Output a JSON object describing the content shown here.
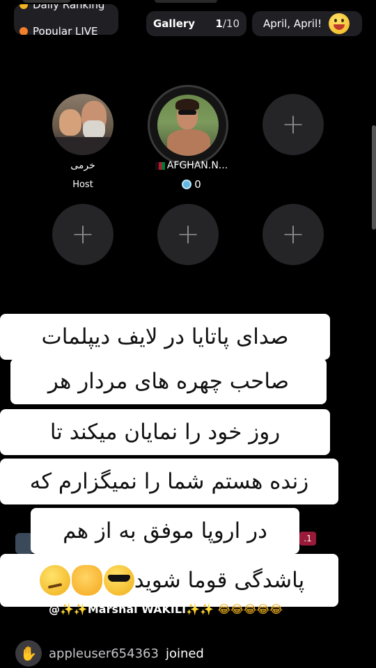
{
  "top_bar": {
    "ranking_line1": "Daily Ranking",
    "ranking_line2": "Popular LIVE",
    "gallery_label": "Gallery",
    "gallery_current": "1",
    "gallery_total": "/10",
    "april_label": "April, April!",
    "april_icon": "laughing-face-icon"
  },
  "seats": {
    "host_name": "خرمی",
    "host_role": "Host",
    "guest_name": "AFGHAN.N...",
    "guest_score": "0",
    "empty_seat_icon": "plus-icon",
    "empty_seat_symbol": "+"
  },
  "caption": {
    "line1": "صدای پاتایا در لایف دیپلمات",
    "line2": "صاحب  چهره های مردار هر",
    "line3": "روز خود را نمایان میکند  تا",
    "line4": "زنده هستم شما را نمیگزارم که",
    "line5": "در اروپا موفق به از هم",
    "line6": "پاشدگی قوما شوید",
    "emojis": [
      "smirk-emoji",
      "fist-emoji",
      "sunglasses-emoji"
    ]
  },
  "chat": {
    "hidden_badge": ".1",
    "partial_message": "@✨✨Marshal WAKILI✨✨",
    "partial_laughs": "😂😂😂😂😂",
    "joined_user": "appleuser654363",
    "joined_verb": "joined",
    "joined_icon": "wave-hand-icon"
  },
  "colors": {
    "background": "#000000",
    "pill": "#1f1f24",
    "empty_seat": "#252528",
    "caption_bg": "#ffffff",
    "score_coin": "#62b8e0"
  }
}
